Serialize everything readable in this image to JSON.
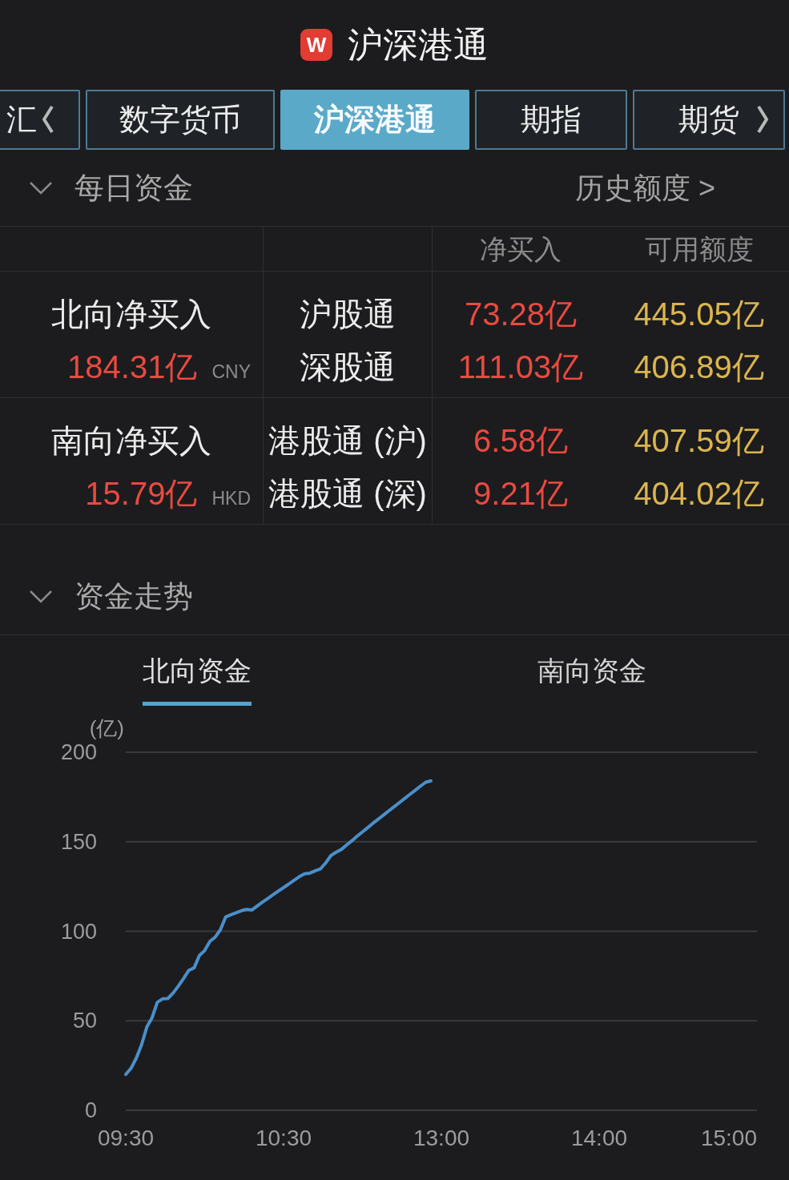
{
  "header": {
    "logo": "W",
    "title": "沪深港通"
  },
  "tabs": [
    {
      "label": "汇",
      "selected": false
    },
    {
      "label": "数字货币",
      "selected": false
    },
    {
      "label": "沪深港通",
      "selected": true
    },
    {
      "label": "期指",
      "selected": false
    },
    {
      "label": "期货",
      "selected": false
    }
  ],
  "daily_funds": {
    "title": "每日资金",
    "expanded": true,
    "link": "历史额度 >",
    "columns": [
      "净买入",
      "可用额度"
    ],
    "groups": [
      {
        "label": "北向净买入",
        "total": "184.31亿",
        "currency": "CNY",
        "channels": [
          {
            "name": "沪股通",
            "net_buy": "73.28亿",
            "quota": "445.05亿"
          },
          {
            "name": "深股通",
            "net_buy": "111.03亿",
            "quota": "406.89亿"
          }
        ]
      },
      {
        "label": "南向净买入",
        "total": "15.79亿",
        "currency": "HKD",
        "channels": [
          {
            "name": "港股通 (沪)",
            "net_buy": "6.58亿",
            "quota": "407.59亿"
          },
          {
            "name": "港股通 (深)",
            "net_buy": "9.21亿",
            "quota": "404.02亿"
          }
        ]
      }
    ]
  },
  "fund_trend": {
    "title": "资金走势",
    "expanded": true,
    "tabs": [
      {
        "label": "北向资金",
        "selected": true
      },
      {
        "label": "南向资金",
        "selected": false
      }
    ],
    "chart_data": {
      "type": "line",
      "ylabel": "(亿)",
      "grid": true,
      "categories": [
        "09:30",
        null,
        null,
        null,
        null,
        null,
        null,
        null,
        null,
        null,
        null,
        null,
        null,
        null,
        null,
        null,
        null,
        null,
        null,
        null,
        null,
        null,
        null,
        null,
        null,
        null,
        null,
        null,
        null,
        null,
        "10:30",
        null,
        null,
        null,
        null,
        null,
        null,
        null,
        null,
        null,
        null,
        null,
        null,
        null,
        null,
        null,
        null,
        null,
        null,
        null,
        null,
        null,
        null,
        null,
        null,
        null,
        null,
        null,
        null,
        null,
        "13:00",
        null,
        null,
        null,
        null,
        null,
        null,
        null,
        null,
        null,
        null,
        null,
        null,
        null,
        null,
        null,
        null,
        null,
        null,
        null,
        null,
        null,
        null,
        null,
        null,
        null,
        null,
        null,
        null,
        null,
        "14:00",
        null,
        null,
        null,
        null,
        null,
        null,
        null,
        null,
        null,
        null,
        null,
        null,
        null,
        null,
        null,
        null,
        null,
        null,
        null,
        null,
        null,
        null,
        null,
        null,
        null,
        null,
        null,
        null,
        null,
        "15:00"
      ],
      "series": [
        {
          "color": "#4a8fcb",
          "values": [
            20.0,
            23.5,
            29.1,
            36.6,
            46.5,
            51.7,
            60.3,
            62.3,
            62.4,
            65.5,
            69.4,
            73.7,
            78.2,
            79.6,
            86.5,
            89.2,
            94.4,
            96.7,
            100.9,
            108.0,
            109.2,
            110.4,
            111.5,
            112.2,
            111.9,
            114.2,
            116.3,
            118.3,
            120.4,
            122.4,
            124.4,
            126.4,
            128.5,
            130.5,
            132.1,
            132.5,
            133.7,
            134.8,
            138.1,
            142.3,
            144.2,
            145.7,
            148.2,
            150.6,
            153.1,
            155.5,
            157.9,
            160.3,
            162.6,
            164.9,
            167.2,
            169.5,
            171.8,
            174.1,
            176.4,
            178.7,
            181.0,
            183.2,
            184.0,
            null,
            null,
            null,
            null,
            null,
            null,
            null,
            null,
            null,
            null,
            null,
            null,
            null,
            null,
            null,
            null,
            null,
            null,
            null,
            null,
            null,
            null,
            null,
            null,
            null,
            null,
            null,
            null,
            null,
            null,
            null,
            null,
            null,
            null,
            null,
            null,
            null,
            null,
            null,
            null,
            null,
            null,
            null,
            null,
            null,
            null,
            null,
            null,
            null,
            null,
            null,
            null,
            null,
            null,
            null,
            null,
            null,
            null,
            null,
            null,
            null,
            null
          ]
        }
      ],
      "ylim": [
        0,
        200
      ],
      "yticks": [
        0,
        50,
        100,
        150,
        200
      ]
    }
  }
}
